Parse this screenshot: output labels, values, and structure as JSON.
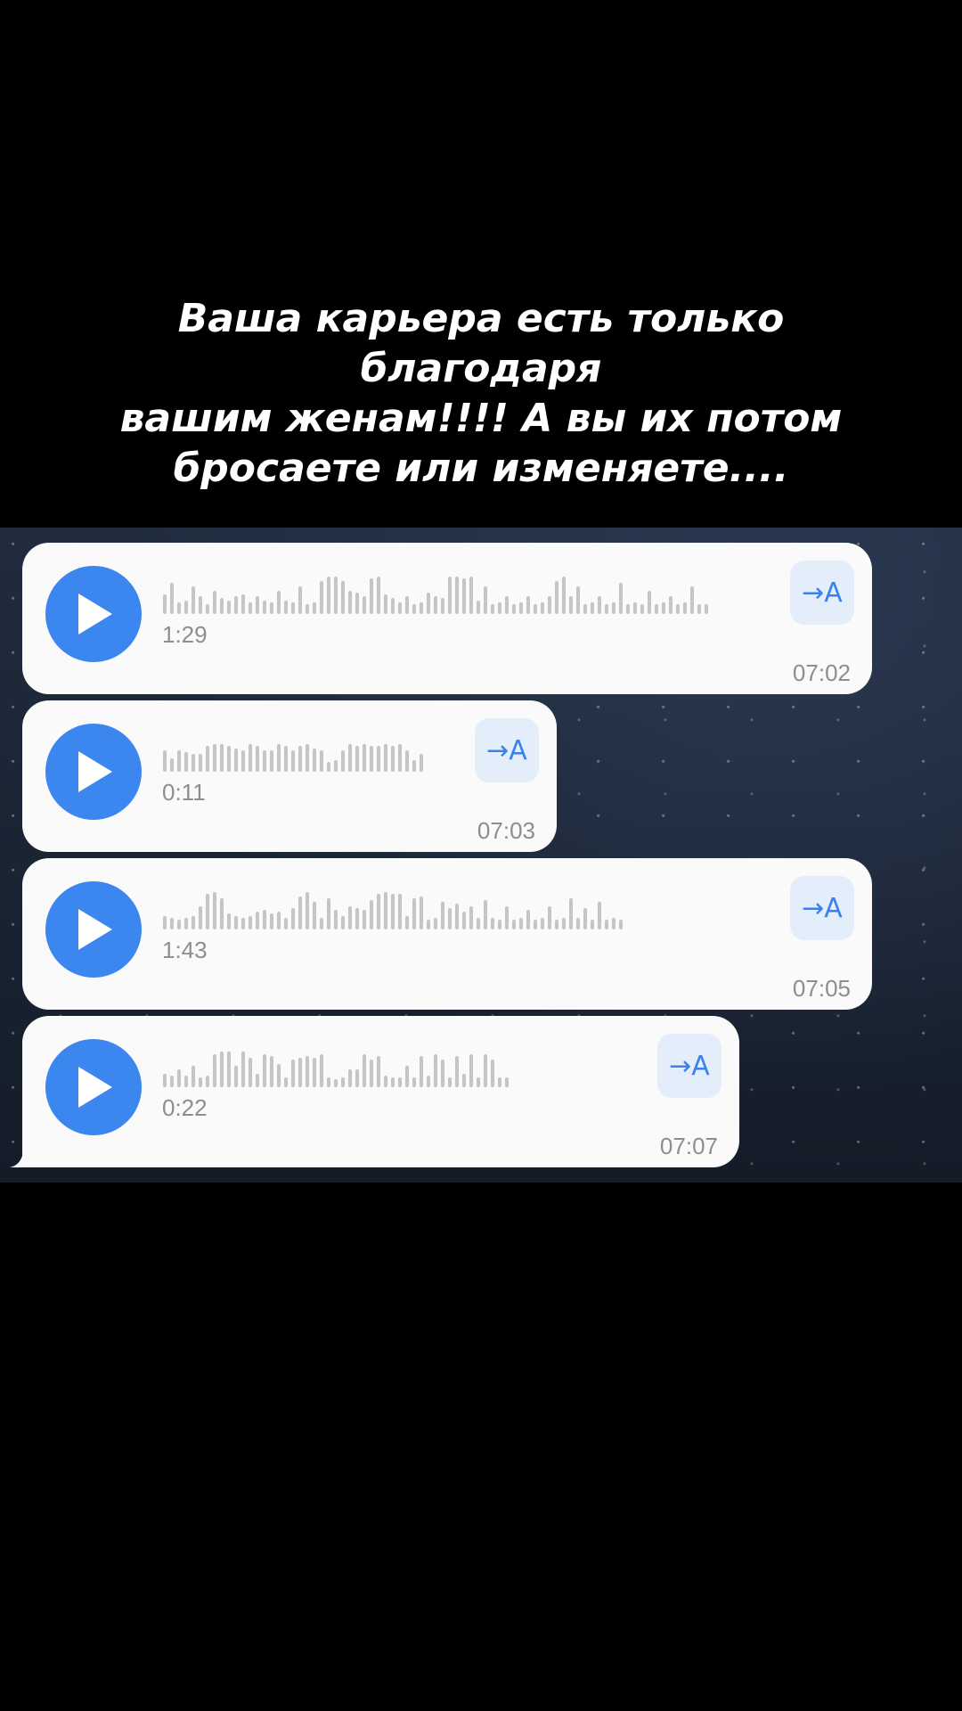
{
  "caption": "Ваша карьера есть только благодаря\nвашим женам!!!! А вы их потом\nбросаете или изменяете....",
  "colors": {
    "play_button": "#3c86f0",
    "bubble": "#fafafa",
    "waveform": "#c5c5c8",
    "meta_text": "#8d8d92",
    "transcribe_bg": "#e4eefb",
    "transcribe_fg": "#3a82e8"
  },
  "messages": [
    {
      "duration": "1:29",
      "time": "07:02",
      "transcribe_label": "→A",
      "play_icon": "play-icon",
      "waveform": [
        0.5,
        0.8,
        0.3,
        0.35,
        0.7,
        0.45,
        0.25,
        0.6,
        0.4,
        0.35,
        0.45,
        0.5,
        0.3,
        0.45,
        0.35,
        0.3,
        0.6,
        0.35,
        0.3,
        0.7,
        0.25,
        0.3,
        0.85,
        0.95,
        0.95,
        0.85,
        0.6,
        0.55,
        0.45,
        0.9,
        0.95,
        0.5,
        0.4,
        0.3,
        0.45,
        0.25,
        0.3,
        0.55,
        0.45,
        0.4,
        0.95,
        0.95,
        0.9,
        0.95,
        0.35,
        0.7,
        0.25,
        0.3,
        0.45,
        0.25,
        0.3,
        0.45,
        0.25,
        0.3,
        0.45,
        0.85,
        0.95,
        0.45,
        0.7,
        0.25,
        0.3,
        0.45,
        0.25,
        0.3,
        0.8,
        0.25,
        0.3,
        0.25,
        0.6,
        0.25,
        0.3,
        0.45,
        0.25,
        0.3,
        0.7,
        0.25,
        0.25
      ]
    },
    {
      "duration": "0:11",
      "time": "07:03",
      "transcribe_label": "→A",
      "play_icon": "play-icon",
      "waveform": [
        0.55,
        0.35,
        0.55,
        0.5,
        0.45,
        0.45,
        0.65,
        0.7,
        0.7,
        0.65,
        0.6,
        0.55,
        0.7,
        0.65,
        0.55,
        0.55,
        0.7,
        0.65,
        0.55,
        0.65,
        0.7,
        0.6,
        0.55,
        0.25,
        0.3,
        0.55,
        0.7,
        0.65,
        0.7,
        0.65,
        0.65,
        0.7,
        0.65,
        0.7,
        0.55,
        0.3,
        0.45
      ]
    },
    {
      "duration": "1:43",
      "time": "07:05",
      "transcribe_label": "→A",
      "play_icon": "play-icon",
      "waveform": [
        0.35,
        0.3,
        0.25,
        0.3,
        0.35,
        0.6,
        0.9,
        0.95,
        0.8,
        0.4,
        0.35,
        0.3,
        0.35,
        0.45,
        0.5,
        0.4,
        0.45,
        0.3,
        0.55,
        0.85,
        0.95,
        0.7,
        0.3,
        0.8,
        0.5,
        0.35,
        0.6,
        0.55,
        0.5,
        0.75,
        0.9,
        0.95,
        0.9,
        0.9,
        0.35,
        0.8,
        0.85,
        0.25,
        0.3,
        0.7,
        0.55,
        0.65,
        0.45,
        0.6,
        0.3,
        0.75,
        0.3,
        0.25,
        0.6,
        0.25,
        0.3,
        0.5,
        0.25,
        0.3,
        0.6,
        0.25,
        0.3,
        0.8,
        0.3,
        0.55,
        0.25,
        0.7,
        0.25,
        0.3,
        0.25
      ]
    },
    {
      "duration": "0:22",
      "time": "07:07",
      "transcribe_label": "→A",
      "play_icon": "play-icon",
      "waveform": [
        0.35,
        0.3,
        0.45,
        0.3,
        0.55,
        0.25,
        0.3,
        0.85,
        0.9,
        0.9,
        0.55,
        0.9,
        0.75,
        0.35,
        0.85,
        0.8,
        0.6,
        0.25,
        0.7,
        0.75,
        0.8,
        0.75,
        0.85,
        0.25,
        0.2,
        0.25,
        0.45,
        0.45,
        0.85,
        0.7,
        0.8,
        0.3,
        0.25,
        0.25,
        0.55,
        0.25,
        0.8,
        0.3,
        0.85,
        0.7,
        0.25,
        0.8,
        0.35,
        0.85,
        0.25,
        0.85,
        0.7,
        0.25,
        0.25
      ]
    }
  ]
}
